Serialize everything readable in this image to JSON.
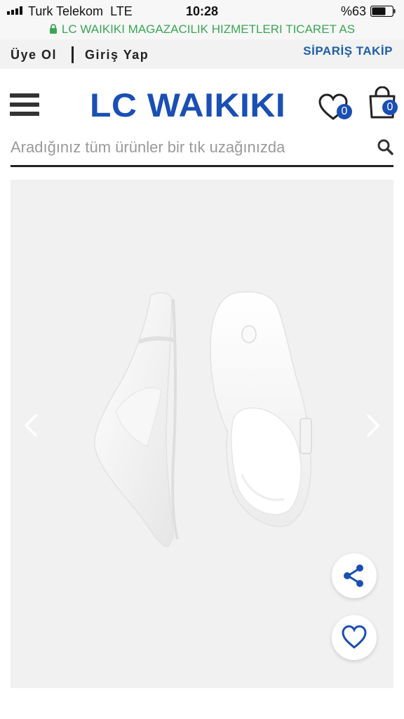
{
  "status_bar": {
    "carrier": "Turk Telekom",
    "network": "LTE",
    "time": "10:28",
    "battery": "%63"
  },
  "secure_bar": {
    "site_name": "LC WAIKIKI MAGAZACILIK HIZMETLERI TICARET AS"
  },
  "account_bar": {
    "register_label": "Üye Ol",
    "login_label": "Giriş Yap",
    "order_tracking_label": "SİPARİŞ TAKİP"
  },
  "header": {
    "logo_text": "LC WAIKIKI",
    "favorites_count": "0",
    "cart_count": "0"
  },
  "search": {
    "placeholder": "Aradığınız tüm ürünler bir tık uzağınızda",
    "value": ""
  },
  "gallery": {
    "image_icon": "white-thong-clog-sandals"
  },
  "colors": {
    "brand_blue": "#1a4fb4",
    "secure_green": "#3aa655",
    "track_blue": "#1f5fa8"
  }
}
